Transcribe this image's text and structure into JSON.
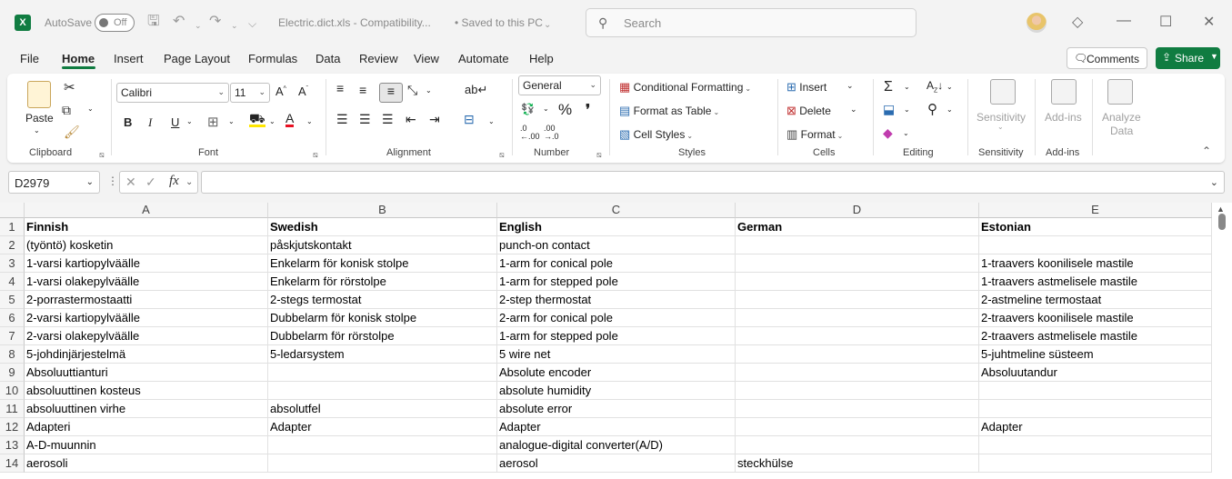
{
  "titlebar": {
    "app_logo": "X",
    "autosave_label": "AutoSave",
    "autosave_state": "Off",
    "doc_title": "Electric.dict.xls  -  Compatibility...",
    "saved_status": "•  Saved to this PC",
    "search_placeholder": "Search"
  },
  "menu": {
    "items": [
      "File",
      "Home",
      "Insert",
      "Page Layout",
      "Formulas",
      "Data",
      "Review",
      "View",
      "Automate",
      "Help"
    ],
    "active": "Home",
    "comments_label": "Comments",
    "share_label": "Share"
  },
  "ribbon": {
    "clipboard": {
      "label": "Clipboard",
      "paste": "Paste"
    },
    "font": {
      "label": "Font",
      "name": "Calibri",
      "size": "11"
    },
    "alignment": {
      "label": "Alignment"
    },
    "number": {
      "label": "Number",
      "format": "General"
    },
    "styles": {
      "label": "Styles",
      "conditional": "Conditional Formatting",
      "format_table": "Format as Table",
      "cell_styles": "Cell Styles"
    },
    "cells": {
      "label": "Cells",
      "insert": "Insert",
      "delete": "Delete",
      "format": "Format"
    },
    "editing": {
      "label": "Editing"
    },
    "sensitivity": {
      "label": "Sensitivity",
      "button": "Sensitivity"
    },
    "addins": {
      "label": "Add-ins",
      "button": "Add-ins"
    },
    "analyze": {
      "button_line1": "Analyze",
      "button_line2": "Data"
    }
  },
  "formula_bar": {
    "name_box": "D2979",
    "fx": "fx",
    "formula": ""
  },
  "sheet": {
    "columns": [
      "A",
      "B",
      "C",
      "D",
      "E"
    ],
    "rows": [
      {
        "n": "1",
        "cells": [
          "Finnish",
          "Swedish",
          "English",
          "German",
          "Estonian"
        ],
        "header": true
      },
      {
        "n": "2",
        "cells": [
          "(työntö) kosketin",
          "påskjutskontakt",
          "punch-on contact",
          "",
          ""
        ]
      },
      {
        "n": "3",
        "cells": [
          "1-varsi kartiopylväälle",
          "Enkelarm för konisk stolpe",
          "1-arm for conical pole",
          "",
          "1-traavers koonilisele mastile"
        ]
      },
      {
        "n": "4",
        "cells": [
          "1-varsi olakepylväälle",
          "Enkelarm för rörstolpe",
          "1-arm for stepped pole",
          "",
          "1-traavers astmelisele mastile"
        ]
      },
      {
        "n": "5",
        "cells": [
          "2-porrastermostaatti",
          "2-stegs termostat",
          "2-step thermostat",
          "",
          "2-astmeline termostaat"
        ]
      },
      {
        "n": "6",
        "cells": [
          "2-varsi kartiopylväälle",
          "Dubbelarm för konisk stolpe",
          "2-arm for conical pole",
          "",
          "2-traavers koonilisele mastile"
        ]
      },
      {
        "n": "7",
        "cells": [
          "2-varsi olakepylväälle",
          "Dubbelarm för rörstolpe",
          "1-arm for stepped pole",
          "",
          "2-traavers astmelisele mastile"
        ]
      },
      {
        "n": "8",
        "cells": [
          "5-johdinjärjestelmä",
          "5-ledarsystem",
          "5 wire net",
          "",
          "5-juhtmeline süsteem"
        ]
      },
      {
        "n": "9",
        "cells": [
          "Absoluuttianturi",
          "",
          "Absolute encoder",
          "",
          "Absoluutandur"
        ]
      },
      {
        "n": "10",
        "cells": [
          "absoluuttinen kosteus",
          "",
          "absolute humidity",
          "",
          ""
        ]
      },
      {
        "n": "11",
        "cells": [
          "absoluuttinen virhe",
          "absolutfel",
          "absolute error",
          "",
          ""
        ]
      },
      {
        "n": "12",
        "cells": [
          "Adapteri",
          "Adapter",
          "Adapter",
          "",
          "Adapter"
        ]
      },
      {
        "n": "13",
        "cells": [
          "A-D-muunnin",
          "",
          "analogue-digital converter(A/D)",
          "",
          ""
        ]
      },
      {
        "n": "14",
        "cells": [
          "aerosoli",
          "",
          "aerosol",
          "steckhülse",
          ""
        ]
      }
    ]
  }
}
